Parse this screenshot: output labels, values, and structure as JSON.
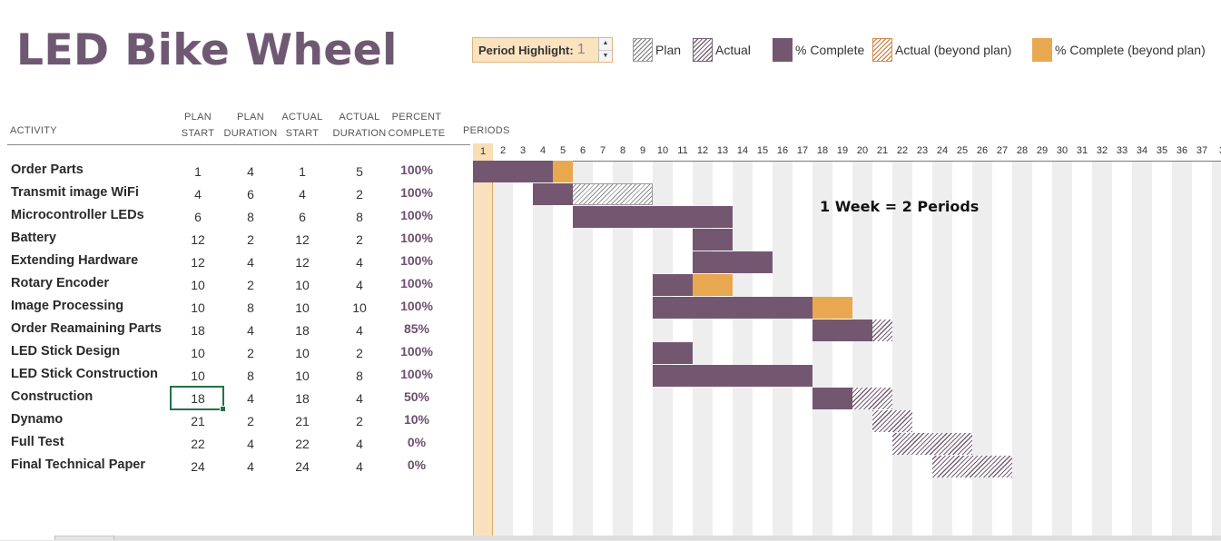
{
  "title": "LED Bike Wheel",
  "period_highlight": {
    "label": "Period Highlight:",
    "value": "1"
  },
  "legend": [
    {
      "label": "Plan",
      "icon": "plan-swatch"
    },
    {
      "label": "Actual",
      "icon": "actual-swatch"
    },
    {
      "label": "% Complete",
      "icon": "complete-swatch"
    },
    {
      "label": "Actual (beyond plan)",
      "icon": "actual-beyond-swatch"
    },
    {
      "label": "% Complete (beyond plan)",
      "icon": "complete-beyond-swatch"
    }
  ],
  "columns": {
    "activity": "ACTIVITY",
    "plan_start": [
      "PLAN",
      "START"
    ],
    "plan_duration": [
      "PLAN",
      "DURATION"
    ],
    "actual_start": [
      "ACTUAL",
      "START"
    ],
    "actual_duration": [
      "ACTUAL",
      "DURATION"
    ],
    "percent_complete": [
      "PERCENT",
      "COMPLETE"
    ],
    "periods": "PERIODS"
  },
  "periods": [
    "1",
    "2",
    "3",
    "4",
    "5",
    "6",
    "7",
    "8",
    "9",
    "10",
    "11",
    "12",
    "13",
    "14",
    "15",
    "16",
    "17",
    "18",
    "19",
    "20",
    "21",
    "22",
    "23",
    "24",
    "25",
    "26",
    "27",
    "28",
    "29",
    "30",
    "31",
    "32",
    "33",
    "34",
    "35",
    "36",
    "37",
    "3"
  ],
  "highlight_period": 1,
  "note": "1 Week = 2 Periods",
  "colors": {
    "title": "#6f5872",
    "complete": "#735771",
    "complete_beyond": "#e8a850",
    "highlight": "#fae1bd",
    "selected_cell_border": "#217346"
  },
  "activities": [
    {
      "name": "Order Parts",
      "plan_start": "1",
      "plan_duration": "4",
      "actual_start": "1",
      "actual_duration": "5",
      "percent": "100%",
      "pct": 100
    },
    {
      "name": "Transmit image WiFi",
      "plan_start": "4",
      "plan_duration": "6",
      "actual_start": "4",
      "actual_duration": "2",
      "percent": "100%",
      "pct": 100
    },
    {
      "name": "Microcontroller LEDs",
      "plan_start": "6",
      "plan_duration": "8",
      "actual_start": "6",
      "actual_duration": "8",
      "percent": "100%",
      "pct": 100
    },
    {
      "name": "Battery",
      "plan_start": "12",
      "plan_duration": "2",
      "actual_start": "12",
      "actual_duration": "2",
      "percent": "100%",
      "pct": 100
    },
    {
      "name": "Extending Hardware",
      "plan_start": "12",
      "plan_duration": "4",
      "actual_start": "12",
      "actual_duration": "4",
      "percent": "100%",
      "pct": 100
    },
    {
      "name": "Rotary Encoder",
      "plan_start": "10",
      "plan_duration": "2",
      "actual_start": "10",
      "actual_duration": "4",
      "percent": "100%",
      "pct": 100
    },
    {
      "name": "Image Processing",
      "plan_start": "10",
      "plan_duration": "8",
      "actual_start": "10",
      "actual_duration": "10",
      "percent": "100%",
      "pct": 100
    },
    {
      "name": "Order Reamaining Parts",
      "plan_start": "18",
      "plan_duration": "4",
      "actual_start": "18",
      "actual_duration": "4",
      "percent": "85%",
      "pct": 85
    },
    {
      "name": "LED Stick Design",
      "plan_start": "10",
      "plan_duration": "2",
      "actual_start": "10",
      "actual_duration": "2",
      "percent": "100%",
      "pct": 100
    },
    {
      "name": "LED Stick Construction",
      "plan_start": "10",
      "plan_duration": "8",
      "actual_start": "10",
      "actual_duration": "8",
      "percent": "100%",
      "pct": 100
    },
    {
      "name": "Construction",
      "plan_start": "18",
      "plan_duration": "4",
      "actual_start": "18",
      "actual_duration": "4",
      "percent": "50%",
      "pct": 50
    },
    {
      "name": "Dynamo",
      "plan_start": "21",
      "plan_duration": "2",
      "actual_start": "21",
      "actual_duration": "2",
      "percent": "10%",
      "pct": 10
    },
    {
      "name": "Full Test",
      "plan_start": "22",
      "plan_duration": "4",
      "actual_start": "22",
      "actual_duration": "4",
      "percent": "0%",
      "pct": 0
    },
    {
      "name": "Final Technical Paper",
      "plan_start": "24",
      "plan_duration": "4",
      "actual_start": "24",
      "actual_duration": "4",
      "percent": "0%",
      "pct": 0
    }
  ]
}
